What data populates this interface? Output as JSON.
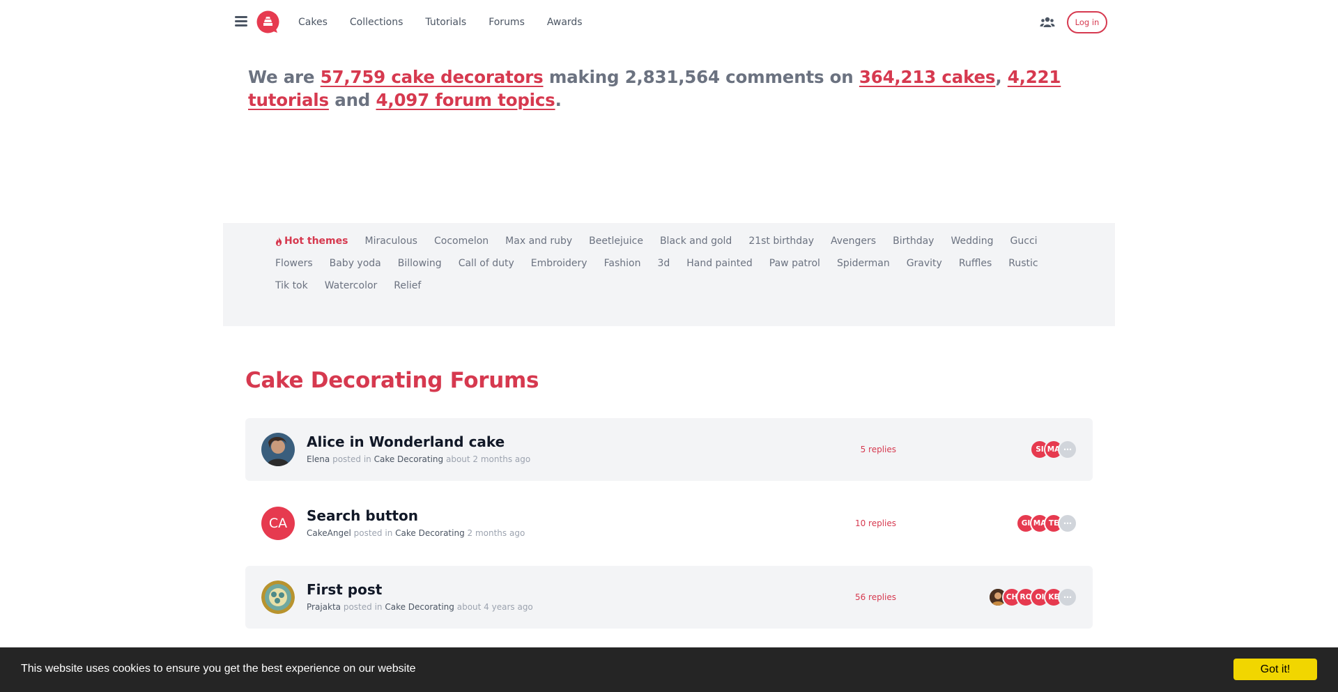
{
  "nav": {
    "links": [
      "Cakes",
      "Collections",
      "Tutorials",
      "Forums",
      "Awards"
    ],
    "login_label": "Log in",
    "brand_color": "#d6394f"
  },
  "stats": {
    "prefix": "We are ",
    "decorators": "57,759 cake decorators",
    "mid1": " making 2,831,564 comments on ",
    "cakes": "364,213 cakes",
    "sep": ", ",
    "tutorials": "4,221 tutorials",
    "and": " and ",
    "forum_topics": "4,097 forum topics",
    "end": "."
  },
  "themes": {
    "hot_label": "Hot themes",
    "items": [
      "Miraculous",
      "Cocomelon",
      "Max and ruby",
      "Beetlejuice",
      "Black and gold",
      "21st birthday",
      "Avengers",
      "Birthday",
      "Wedding",
      "Gucci",
      "Flowers",
      "Baby yoda",
      "Billowing",
      "Call of duty",
      "Embroidery",
      "Fashion",
      "3d",
      "Hand painted",
      "Paw patrol",
      "Spiderman",
      "Gravity",
      "Ruffles",
      "Rustic",
      "Tik tok",
      "Watercolor",
      "Relief"
    ]
  },
  "forums": {
    "title": "Cake Decorating Forums",
    "posted_in": "posted in",
    "topics": [
      {
        "title": "Alice in Wonderland cake",
        "author": "Elena",
        "category": "Cake Decorating",
        "time": "about 2 months ago",
        "replies": "5 replies",
        "avatar_initials": "",
        "participants": [
          "SI",
          "MA"
        ]
      },
      {
        "title": "Search button",
        "author": "CakeAngel",
        "category": "Cake Decorating",
        "time": "2 months ago",
        "replies": "10 replies",
        "avatar_initials": "CA",
        "participants": [
          "GI",
          "MA",
          "TE"
        ]
      },
      {
        "title": "First post",
        "author": "Prajakta",
        "category": "Cake Decorating",
        "time": "about 4 years ago",
        "replies": "56 replies",
        "avatar_initials": "",
        "participants": [
          "",
          "CH",
          "RO",
          "OI",
          "KE"
        ]
      }
    ]
  },
  "cookie": {
    "message": "This website uses cookies to ensure you get the best experience on our website",
    "button": "Got it!"
  }
}
